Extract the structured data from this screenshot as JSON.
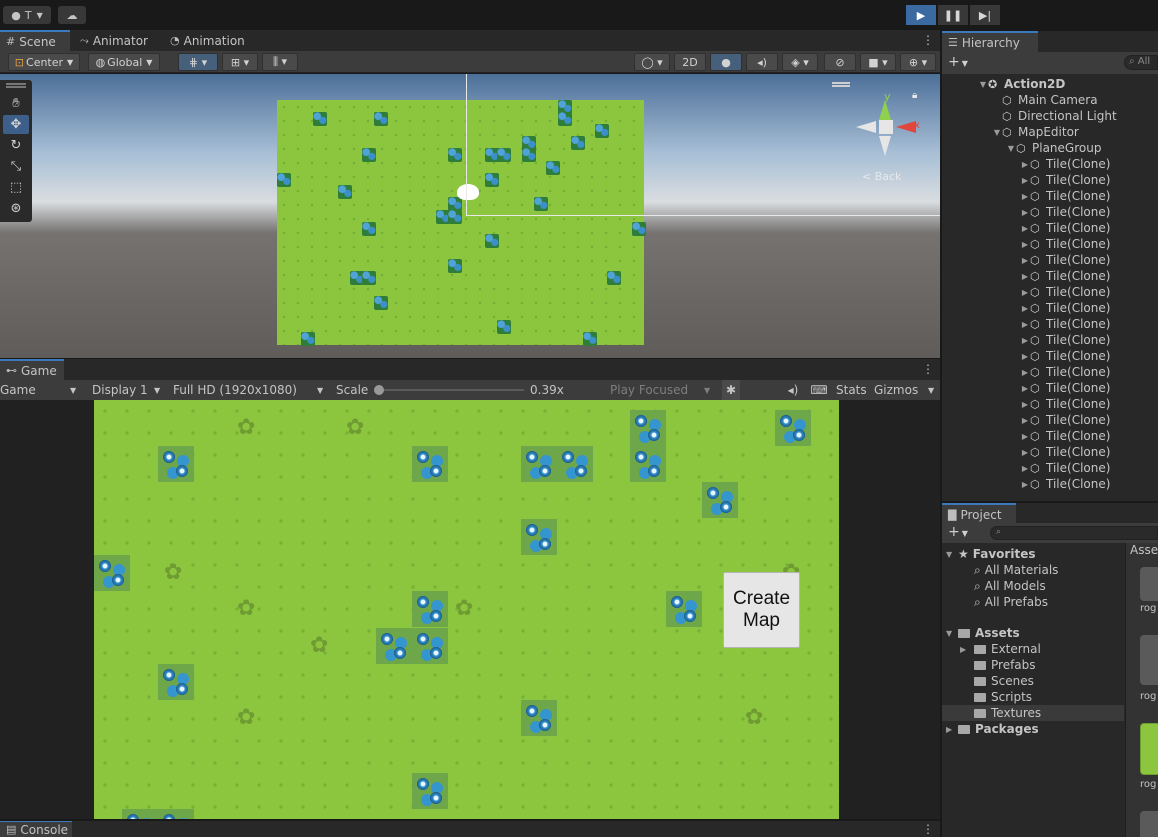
{
  "topbar": {
    "account_label": "T",
    "cloud_icon": "cloud-icon",
    "play_icon": "play-icon",
    "pause_icon": "pause-icon",
    "step_icon": "step-icon"
  },
  "scene_tabs": [
    {
      "label": "Scene",
      "icon": "grid-icon"
    },
    {
      "label": "Animator",
      "icon": "animator-icon"
    },
    {
      "label": "Animation",
      "icon": "clock-icon"
    }
  ],
  "scene_toolbar": {
    "pivot": "Center",
    "space": "Global",
    "mode_2d": "2D"
  },
  "scene_gizmo": {
    "y_axis": "y",
    "x_axis": "x",
    "back_label": "< Back"
  },
  "game_panel": {
    "tab_label": "Game",
    "view_select": "Game",
    "display": "Display 1",
    "resolution": "Full HD (1920x1080)",
    "scale_label": "Scale",
    "scale_value": "0.39x",
    "play_mode": "Play Focused",
    "stats": "Stats",
    "gizmos": "Gizmos",
    "create_map_line1": "Create",
    "create_map_line2": "Map"
  },
  "hierarchy": {
    "tab_label": "Hierarchy",
    "search_placeholder": "All",
    "items": [
      {
        "label": "Action2D",
        "depth": 0,
        "bold": true
      },
      {
        "label": "Main Camera",
        "depth": 1
      },
      {
        "label": "Directional Light",
        "depth": 1
      },
      {
        "label": "MapEditor",
        "depth": 1
      },
      {
        "label": "PlaneGroup",
        "depth": 2
      },
      {
        "label": "Tile(Clone)",
        "depth": 3
      },
      {
        "label": "Tile(Clone)",
        "depth": 3
      },
      {
        "label": "Tile(Clone)",
        "depth": 3
      },
      {
        "label": "Tile(Clone)",
        "depth": 3
      },
      {
        "label": "Tile(Clone)",
        "depth": 3
      },
      {
        "label": "Tile(Clone)",
        "depth": 3
      },
      {
        "label": "Tile(Clone)",
        "depth": 3
      },
      {
        "label": "Tile(Clone)",
        "depth": 3
      },
      {
        "label": "Tile(Clone)",
        "depth": 3
      },
      {
        "label": "Tile(Clone)",
        "depth": 3
      },
      {
        "label": "Tile(Clone)",
        "depth": 3
      },
      {
        "label": "Tile(Clone)",
        "depth": 3
      },
      {
        "label": "Tile(Clone)",
        "depth": 3
      },
      {
        "label": "Tile(Clone)",
        "depth": 3
      },
      {
        "label": "Tile(Clone)",
        "depth": 3
      },
      {
        "label": "Tile(Clone)",
        "depth": 3
      },
      {
        "label": "Tile(Clone)",
        "depth": 3
      },
      {
        "label": "Tile(Clone)",
        "depth": 3
      },
      {
        "label": "Tile(Clone)",
        "depth": 3
      },
      {
        "label": "Tile(Clone)",
        "depth": 3
      },
      {
        "label": "Tile(Clone)",
        "depth": 3
      }
    ]
  },
  "project": {
    "tab_label": "Project",
    "assets_header": "Asse",
    "favorites_label": "Favorites",
    "favorites": [
      "All Materials",
      "All Models",
      "All Prefabs"
    ],
    "assets_label": "Assets",
    "asset_folders": [
      "External",
      "Prefabs",
      "Scenes",
      "Scripts",
      "Textures"
    ],
    "packages_label": "Packages",
    "thumb_labels": [
      "rog",
      "rog",
      "rog"
    ]
  },
  "console": {
    "tab_label": "Console"
  },
  "colors": {
    "accent": "#3a79bb",
    "grass": "#8cc63f",
    "panel": "#282828"
  }
}
